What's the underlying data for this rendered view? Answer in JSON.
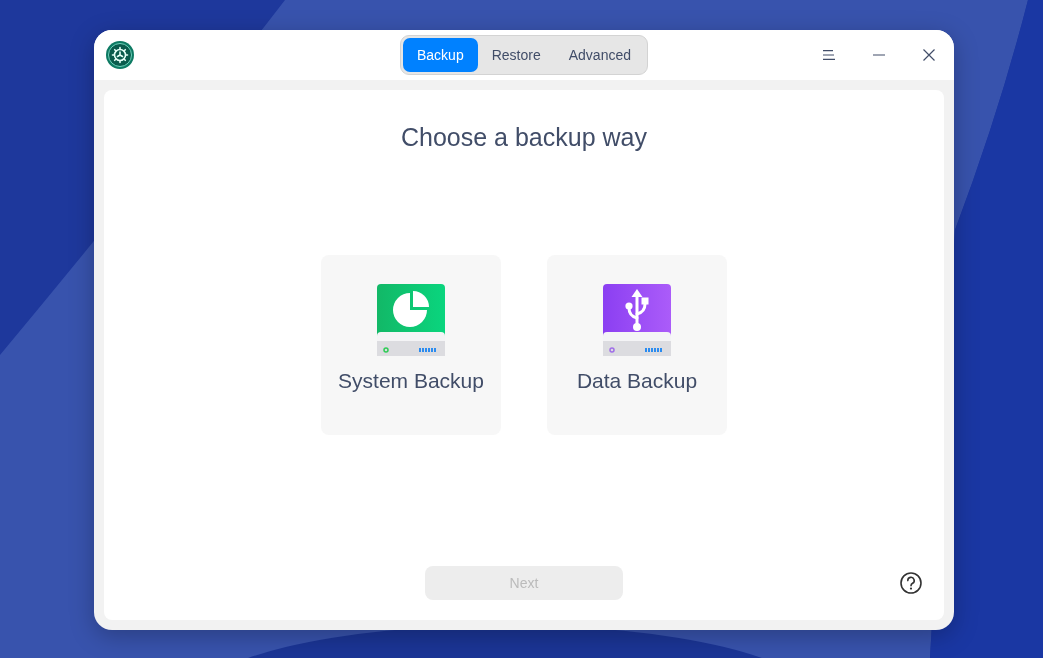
{
  "window": {
    "tabs": [
      {
        "label": "Backup",
        "selected": true
      },
      {
        "label": "Restore",
        "selected": false
      },
      {
        "label": "Advanced",
        "selected": false
      }
    ]
  },
  "page": {
    "title": "Choose a backup way",
    "options": [
      {
        "kind": "system",
        "label": "System Backup",
        "selected": false
      },
      {
        "kind": "data",
        "label": "Data Backup",
        "selected": false
      }
    ],
    "next_button": {
      "label": "Next",
      "disabled": true
    }
  }
}
